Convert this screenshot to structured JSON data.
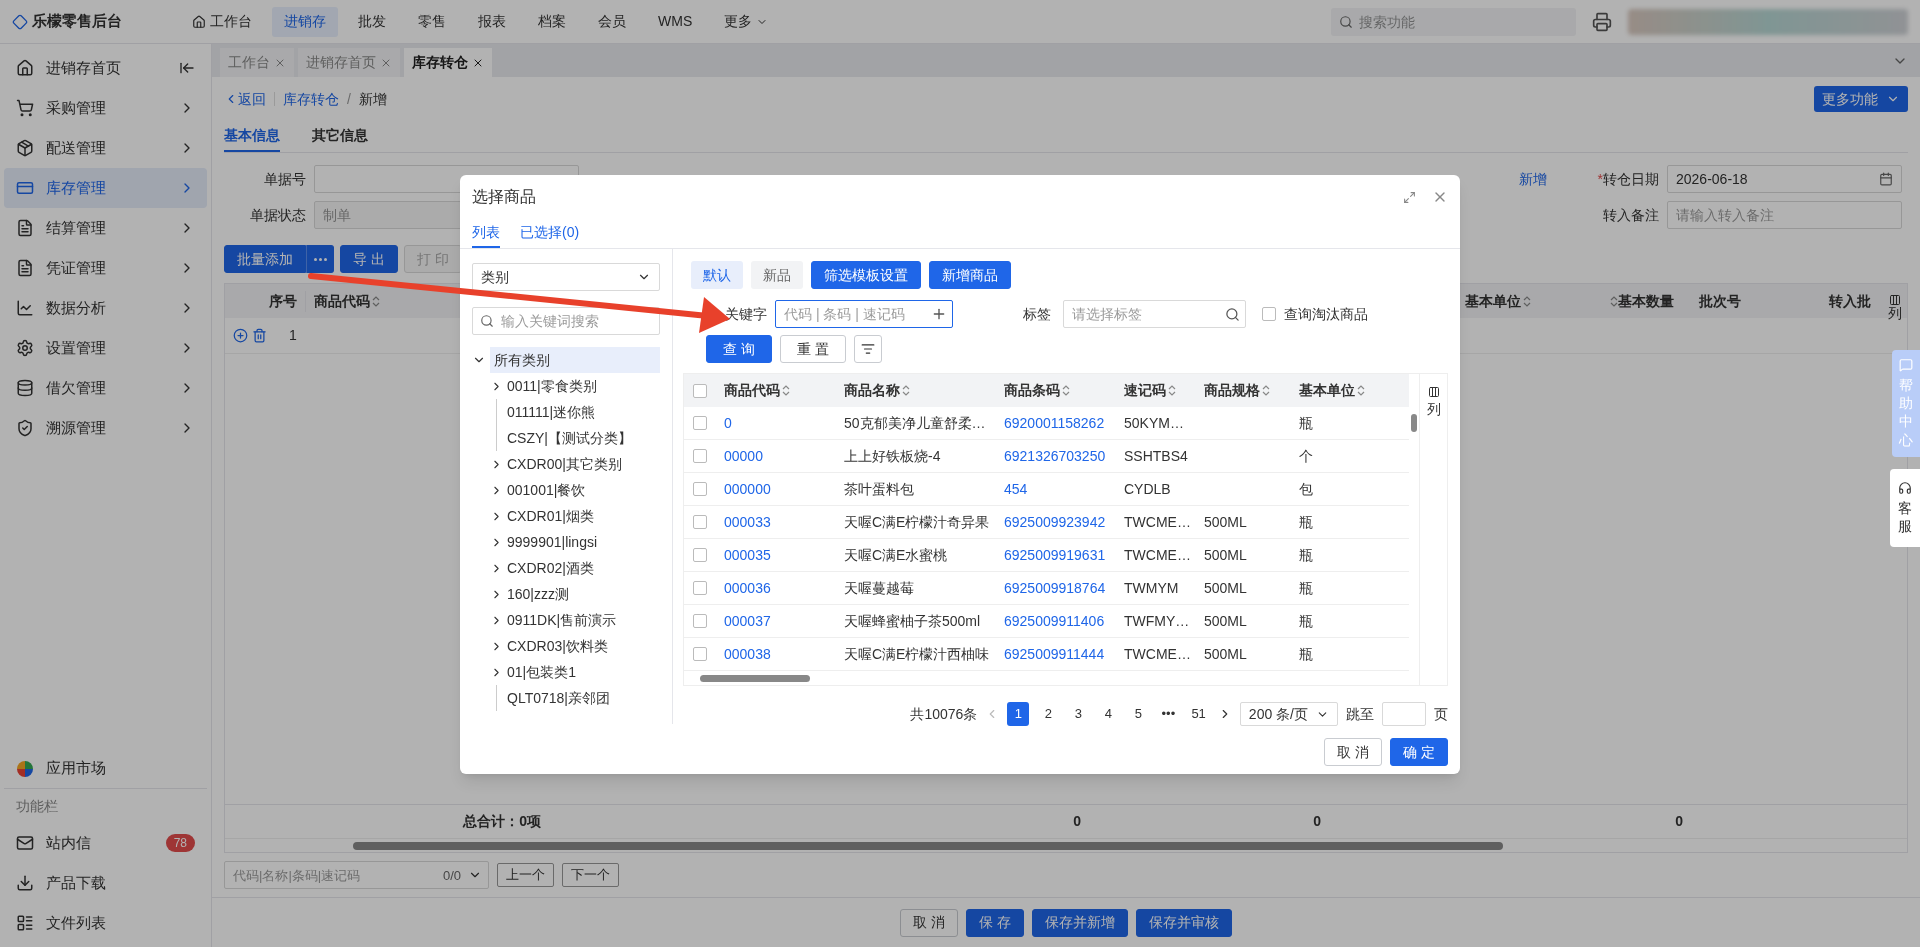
{
  "top_nav": {
    "brand": "乐檬零售后台",
    "items": [
      {
        "label": "工作台",
        "selected": false,
        "kind": "home"
      },
      {
        "label": "进销存",
        "selected": true,
        "kind": "plain"
      },
      {
        "label": "批发",
        "selected": false,
        "kind": "plain"
      },
      {
        "label": "零售",
        "selected": false,
        "kind": "plain"
      },
      {
        "label": "报表",
        "selected": false,
        "kind": "plain"
      },
      {
        "label": "档案",
        "selected": false,
        "kind": "plain"
      },
      {
        "label": "会员",
        "selected": false,
        "kind": "plain"
      },
      {
        "label": "WMS",
        "selected": false,
        "kind": "plain"
      },
      {
        "label": "更多",
        "selected": false,
        "kind": "dropdown"
      }
    ],
    "search_placeholder": "搜索功能"
  },
  "sidebar": {
    "home": {
      "label": "进销存首页",
      "selected": false
    },
    "items": [
      {
        "label": "采购管理",
        "selected": false
      },
      {
        "label": "配送管理",
        "selected": false
      },
      {
        "label": "库存管理",
        "selected": true
      },
      {
        "label": "结算管理",
        "selected": false
      },
      {
        "label": "凭证管理",
        "selected": false
      },
      {
        "label": "数据分析",
        "selected": false
      },
      {
        "label": "设置管理",
        "selected": false
      },
      {
        "label": "借欠管理",
        "selected": false
      },
      {
        "label": "溯源管理",
        "selected": false
      }
    ],
    "app_market": "应用市场",
    "section_label": "功能栏",
    "tools": [
      {
        "label": "站内信",
        "badge": "78"
      },
      {
        "label": "产品下载"
      },
      {
        "label": "文件列表"
      }
    ]
  },
  "page_tabs": [
    {
      "label": "工作台",
      "selected": false
    },
    {
      "label": "进销存首页",
      "selected": false
    },
    {
      "label": "库存转仓",
      "selected": true
    }
  ],
  "breadcrumb": {
    "back": "返回",
    "parent": "库存转仓",
    "separator": "/",
    "current": "新增"
  },
  "more_button": "更多功能",
  "form_tabs": [
    {
      "label": "基本信息",
      "selected": true
    },
    {
      "label": "其它信息",
      "selected": false
    }
  ],
  "form": {
    "bill_no_label": "单据号",
    "status_label": "单据状态",
    "status_placeholder": "制单",
    "add_link": "新增",
    "date_required_mark": "*",
    "date_label": "转仓日期",
    "date_value": "2026-06-18",
    "remark_label": "转入备注",
    "remark_placeholder": "请输入转入备注"
  },
  "actions": [
    {
      "label": "批量添加",
      "kind": "split",
      "disabled": false
    },
    {
      "label": "导 出",
      "kind": "primary",
      "disabled": false
    },
    {
      "label": "打 印",
      "kind": "default",
      "disabled": true
    }
  ],
  "detail_table": {
    "columns_left": [
      "序号",
      "商品代码"
    ],
    "columns_right": [
      "基本单位",
      "基本数量",
      "批次号",
      "转入批"
    ],
    "column_settings": "列",
    "rows": [
      {
        "index": "1"
      }
    ],
    "total_label": "总合计：0项",
    "totals": [
      "0",
      "0",
      "0"
    ]
  },
  "bottom_search": {
    "placeholder": "代码|名称|条码|速记码",
    "count": "0/0",
    "prev": "上一个",
    "next": "下一个"
  },
  "footer_buttons": [
    {
      "label": "取 消",
      "kind": "default"
    },
    {
      "label": "保 存",
      "kind": "primary"
    },
    {
      "label": "保存并新增",
      "kind": "primary"
    },
    {
      "label": "保存并审核",
      "kind": "primary"
    }
  ],
  "float_tabs": [
    {
      "label": "帮助中心",
      "kind": "help"
    },
    {
      "label": "客服",
      "kind": "service"
    }
  ],
  "modal": {
    "title": "选择商品",
    "tabs": [
      {
        "label": "列表",
        "selected": true
      },
      {
        "label": "已选择(0)",
        "selected": false
      }
    ],
    "category_select": "类别",
    "tree_search_placeholder": "输入关键词搜索",
    "tree": [
      {
        "label": "所有类别",
        "expanded": true,
        "selected": true,
        "children": [
          {
            "label": "0011|零食类别",
            "kind": "branch"
          },
          {
            "label": "011111|迷你熊",
            "kind": "leaf"
          },
          {
            "label": "CSZY|【测试分类】",
            "kind": "leaf"
          },
          {
            "label": "CXDR00|其它类别",
            "kind": "branch"
          },
          {
            "label": "001001|餐饮",
            "kind": "branch"
          },
          {
            "label": "CXDR01|烟类",
            "kind": "branch"
          },
          {
            "label": "9999901|lingsi",
            "kind": "branch"
          },
          {
            "label": "CXDR02|酒类",
            "kind": "branch"
          },
          {
            "label": "160|zzz测",
            "kind": "branch"
          },
          {
            "label": "0911DK|售前演示",
            "kind": "branch"
          },
          {
            "label": "CXDR03|饮料类",
            "kind": "branch"
          },
          {
            "label": "01|包装类1",
            "kind": "branch"
          },
          {
            "label": "QLT0718|亲邻团",
            "kind": "leaf"
          }
        ]
      }
    ],
    "filter_tags": [
      {
        "label": "默认",
        "selected": true
      },
      {
        "label": "新品",
        "selected": false
      }
    ],
    "filter_actions": [
      "筛选模板设置",
      "新增商品"
    ],
    "keyword_label": "关键字",
    "keyword_placeholder": "代码 | 条码 | 速记码",
    "tag_label": "标签",
    "tag_placeholder": "请选择标签",
    "obsolete_checkbox": {
      "label": "查询淘汰商品",
      "checked": false
    },
    "query_button": "查 询",
    "reset_button": "重 置",
    "table": {
      "select_all_checked": false,
      "columns": [
        "商品代码",
        "商品名称",
        "商品条码",
        "速记码",
        "商品规格",
        "基本单位"
      ],
      "column_settings": "列",
      "rows": [
        {
          "checked": false,
          "cells": [
            "0",
            "50克郁美净儿童舒柔…",
            "6920001158262",
            "50KYM…",
            "",
            "瓶"
          ]
        },
        {
          "checked": false,
          "cells": [
            "00000",
            "上上好铁板烧-4",
            "6921326703250",
            "SSHTBS4",
            "",
            "个"
          ]
        },
        {
          "checked": false,
          "cells": [
            "000000",
            "茶叶蛋料包",
            "454",
            "CYDLB",
            "",
            "包"
          ]
        },
        {
          "checked": false,
          "cells": [
            "000033",
            "天喔C满E柠檬汁奇异果",
            "6925009923942",
            "TWCME…",
            "500ML",
            "瓶"
          ]
        },
        {
          "checked": false,
          "cells": [
            "000035",
            "天喔C满E水蜜桃",
            "6925009919631",
            "TWCME…",
            "500ML",
            "瓶"
          ]
        },
        {
          "checked": false,
          "cells": [
            "000036",
            "天喔蔓越莓",
            "6925009918764",
            "TWMYM",
            "500ML",
            "瓶"
          ]
        },
        {
          "checked": false,
          "cells": [
            "000037",
            "天喔蜂蜜柚子茶500ml",
            "6925009911406",
            "TWFMY…",
            "500ML",
            "瓶"
          ]
        },
        {
          "checked": false,
          "cells": [
            "000038",
            "天喔C满E柠檬汁西柚味",
            "6925009911444",
            "TWCME…",
            "500ML",
            "瓶"
          ]
        }
      ]
    },
    "pagination": {
      "total": "共10076条",
      "pages": [
        {
          "label": "1",
          "selected": true
        },
        {
          "label": "2",
          "selected": false
        },
        {
          "label": "3",
          "selected": false
        },
        {
          "label": "4",
          "selected": false
        },
        {
          "label": "5",
          "selected": false
        },
        {
          "label": "•••",
          "selected": false
        },
        {
          "label": "51",
          "selected": false
        }
      ],
      "page_size": "200 条/页",
      "jump_label": "跳至",
      "page_unit": "页"
    },
    "cancel": "取 消",
    "confirm": "确 定"
  }
}
